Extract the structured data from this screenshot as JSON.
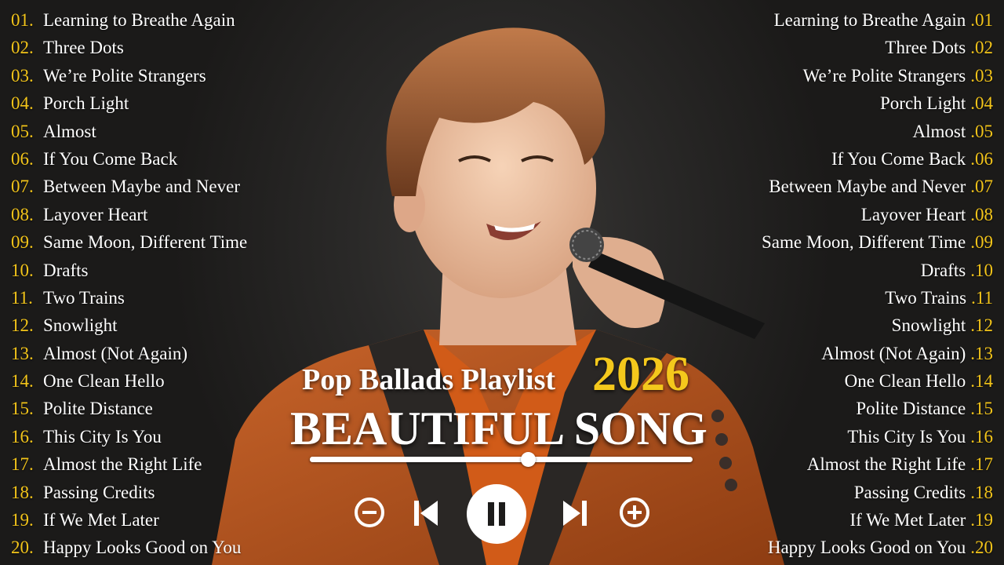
{
  "tracks": [
    {
      "num": "01.",
      "title": "Learning to Breathe Again"
    },
    {
      "num": "02.",
      "title": "Three Dots"
    },
    {
      "num": "03.",
      "title": "We’re Polite Strangers"
    },
    {
      "num": "04.",
      "title": "Porch Light"
    },
    {
      "num": "05.",
      "title": "Almost"
    },
    {
      "num": "06.",
      "title": "If You Come Back"
    },
    {
      "num": "07.",
      "title": "Between Maybe and Never"
    },
    {
      "num": "08.",
      "title": "Layover Heart"
    },
    {
      "num": "09.",
      "title": "Same Moon, Different Time"
    },
    {
      "num": "10.",
      "title": "Drafts"
    },
    {
      "num": "11.",
      "title": "Two Trains"
    },
    {
      "num": "12.",
      "title": "Snowlight"
    },
    {
      "num": "13.",
      "title": "Almost (Not Again)"
    },
    {
      "num": "14.",
      "title": "One Clean Hello"
    },
    {
      "num": "15.",
      "title": "Polite Distance"
    },
    {
      "num": "16.",
      "title": "This City Is You"
    },
    {
      "num": "17.",
      "title": "Almost the Right Life"
    },
    {
      "num": "18.",
      "title": "Passing Credits"
    },
    {
      "num": "19.",
      "title": "If We Met Later"
    },
    {
      "num": "20.",
      "title": "Happy Looks Good on You"
    }
  ],
  "tracks_right": [
    {
      "num": ".01",
      "title": "Learning to Breathe Again"
    },
    {
      "num": ".02",
      "title": "Three Dots"
    },
    {
      "num": ".03",
      "title": "We’re Polite Strangers"
    },
    {
      "num": ".04",
      "title": "Porch Light"
    },
    {
      "num": ".05",
      "title": "Almost"
    },
    {
      "num": ".06",
      "title": "If You Come Back"
    },
    {
      "num": ".07",
      "title": "Between Maybe and Never"
    },
    {
      "num": ".08",
      "title": "Layover Heart"
    },
    {
      "num": ".09",
      "title": "Same Moon, Different Time"
    },
    {
      "num": ".10",
      "title": "Drafts"
    },
    {
      "num": ".11",
      "title": "Two Trains"
    },
    {
      "num": ".12",
      "title": "Snowlight"
    },
    {
      "num": ".13",
      "title": "Almost (Not Again)"
    },
    {
      "num": ".14",
      "title": "One Clean Hello"
    },
    {
      "num": ".15",
      "title": "Polite Distance"
    },
    {
      "num": ".16",
      "title": "This City Is You"
    },
    {
      "num": ".17",
      "title": "Almost the Right Life"
    },
    {
      "num": ".18",
      "title": "Passing Credits"
    },
    {
      "num": ".19",
      "title": "If We Met Later"
    },
    {
      "num": ".20",
      "title": "Happy Looks Good on You"
    }
  ],
  "hero": {
    "title": "Pop Ballads Playlist",
    "year": "2026",
    "subtitle": "BEAUTIFUL SONG"
  },
  "player": {
    "progress_fraction": 0.57,
    "controls": [
      "minus-circle-icon",
      "skip-previous-icon",
      "pause-icon",
      "skip-next-icon",
      "plus-circle-icon"
    ]
  },
  "colors": {
    "track_number": "#f2c41a",
    "year": "#f4c81c",
    "text": "#ffffff",
    "background": "#1d1c1b",
    "jacket": "#b9541d"
  }
}
